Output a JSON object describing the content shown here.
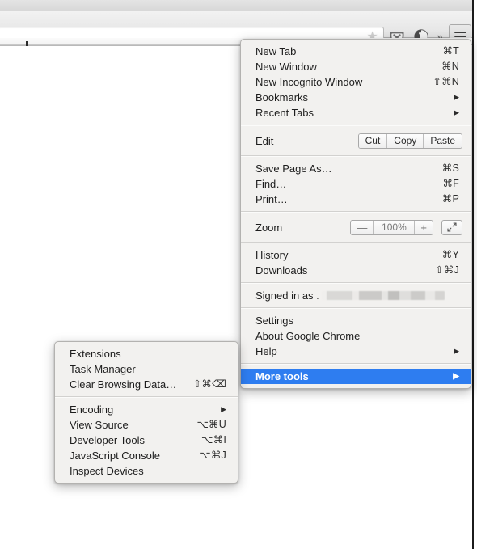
{
  "browser": {
    "omnibox": {
      "value": "",
      "placeholder": ""
    },
    "toolbar_icons": {
      "star": "★",
      "pocket": "pocket-icon",
      "onepassword": "1password-icon",
      "overflow": "»",
      "menu": "hamburger-icon"
    }
  },
  "main_menu": {
    "sections": [
      {
        "items": [
          {
            "label": "New Tab",
            "accel": "⌘T"
          },
          {
            "label": "New Window",
            "accel": "⌘N"
          },
          {
            "label": "New Incognito Window",
            "accel": "⇧⌘N"
          },
          {
            "label": "Bookmarks",
            "accel": "",
            "arrow": "▶"
          },
          {
            "label": "Recent Tabs",
            "accel": "",
            "arrow": "▶"
          }
        ]
      },
      {
        "edit_row": {
          "label": "Edit",
          "buttons": [
            "Cut",
            "Copy",
            "Paste"
          ]
        }
      },
      {
        "items": [
          {
            "label": "Save Page As…",
            "accel": "⌘S"
          },
          {
            "label": "Find…",
            "accel": "⌘F"
          },
          {
            "label": "Print…",
            "accel": "⌘P"
          }
        ]
      },
      {
        "zoom_row": {
          "label": "Zoom",
          "minus": "—",
          "level": "100%",
          "plus": "+",
          "fullscreen_icon": "fullscreen-icon"
        }
      },
      {
        "items": [
          {
            "label": "History",
            "accel": "⌘Y"
          },
          {
            "label": "Downloads",
            "accel": "⇧⌘J"
          }
        ]
      },
      {
        "signed_in": {
          "prefix": "Signed in as",
          "account": ""
        }
      },
      {
        "items": [
          {
            "label": "Settings",
            "accel": ""
          },
          {
            "label": "About Google Chrome",
            "accel": ""
          },
          {
            "label": "Help",
            "accel": "",
            "arrow": "▶"
          }
        ]
      },
      {
        "items": [
          {
            "label": "More tools",
            "accel": "",
            "arrow": "▶",
            "highlighted": true
          }
        ]
      }
    ]
  },
  "sub_menu": {
    "group_a": [
      {
        "label": "Extensions",
        "accel": ""
      },
      {
        "label": "Task Manager",
        "accel": ""
      },
      {
        "label": "Clear Browsing Data…",
        "accel": "⇧⌘⌫"
      }
    ],
    "group_b": [
      {
        "label": "Encoding",
        "accel": "",
        "arrow": "▶"
      },
      {
        "label": "View Source",
        "accel": "⌥⌘U"
      },
      {
        "label": "Developer Tools",
        "accel": "⌥⌘I"
      },
      {
        "label": "JavaScript Console",
        "accel": "⌥⌘J"
      },
      {
        "label": "Inspect Devices",
        "accel": ""
      }
    ]
  },
  "colors": {
    "highlight": "#2e7df0",
    "menu_bg": "#f2f1ef",
    "menu_border": "#b3b2b0"
  }
}
